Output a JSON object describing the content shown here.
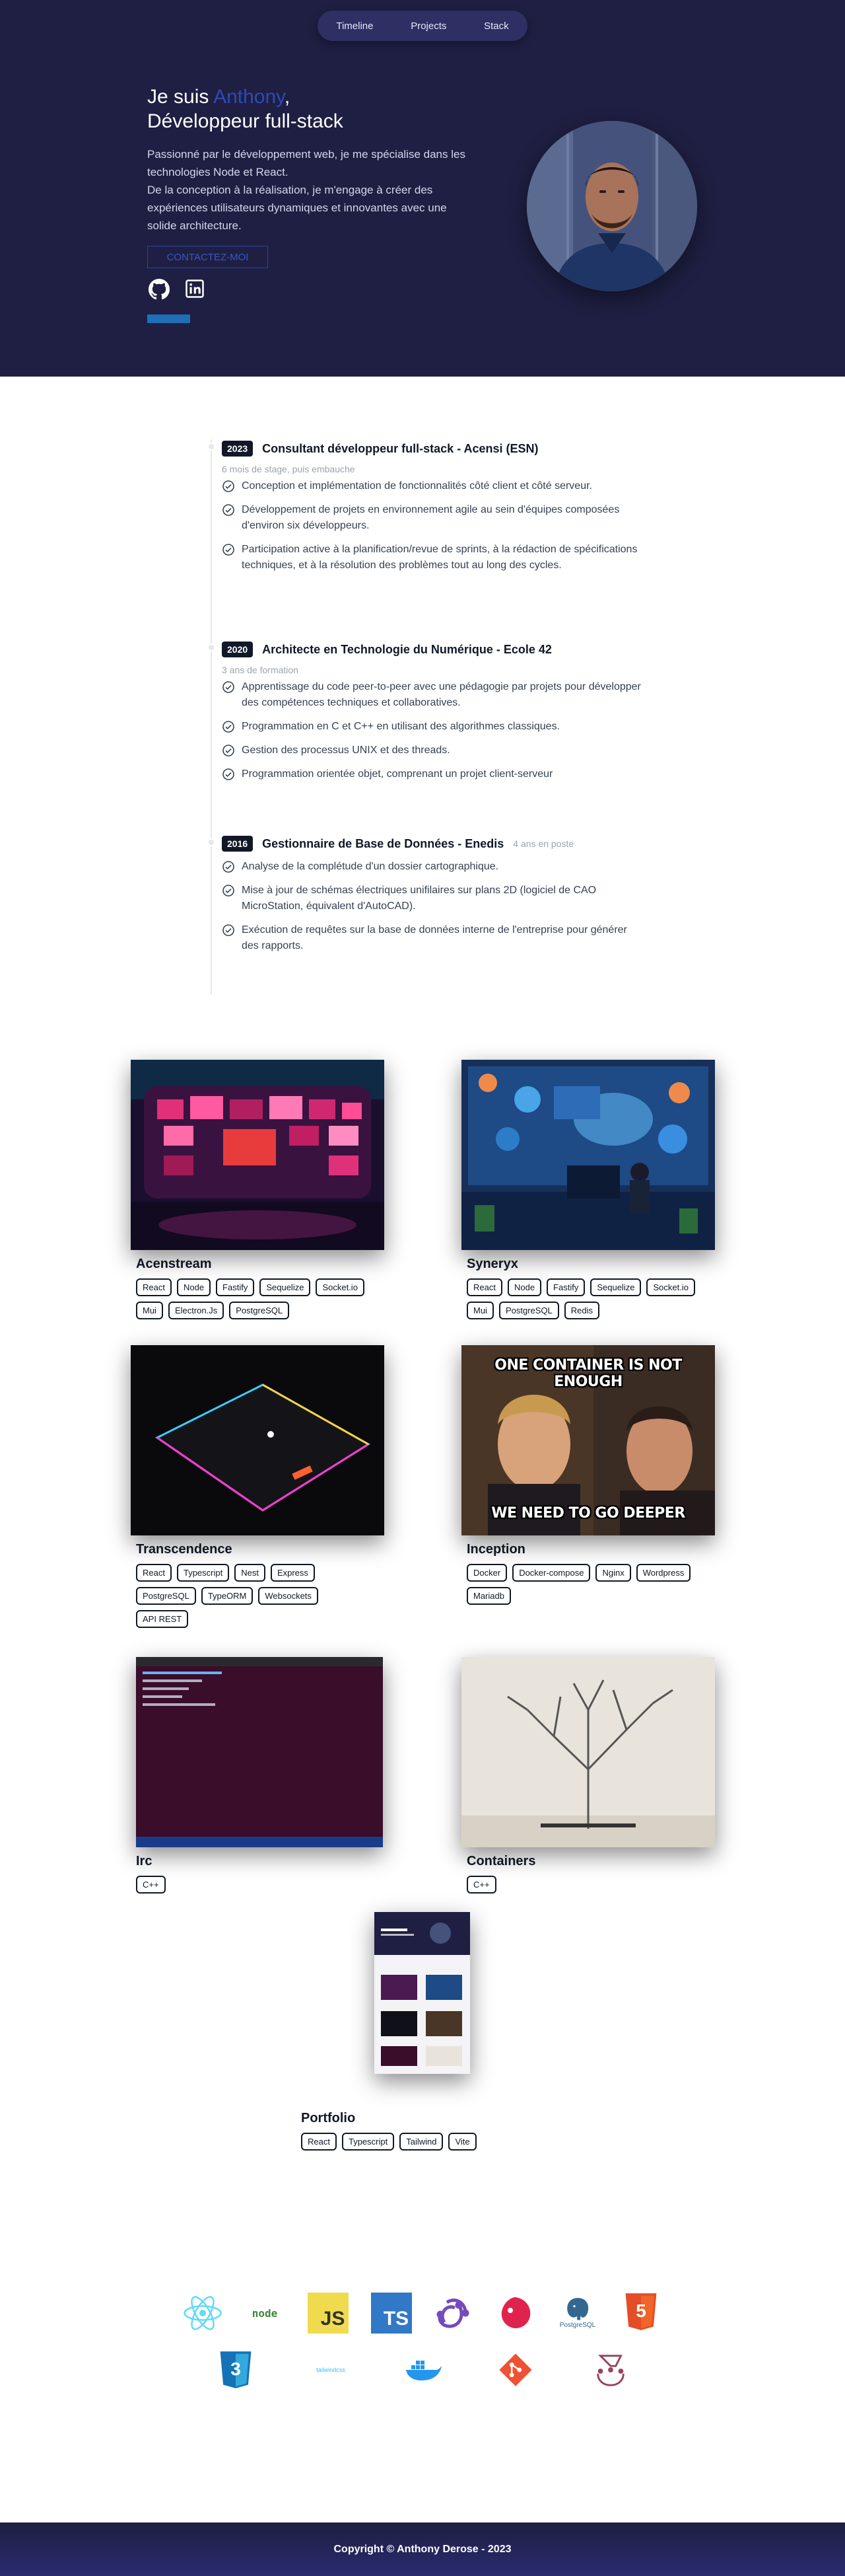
{
  "nav": {
    "items": [
      "Timeline",
      "Projects",
      "Stack"
    ]
  },
  "hero": {
    "greeting": "Je suis ",
    "name": "Anthony",
    "comma": ",",
    "role": "Développeur full-stack",
    "intro_1": "Passionné par le développement web, je me spécialise dans les technologies Node et React.",
    "intro_2": "De la conception à la réalisation, je m'engage à créer des expériences utilisateurs dynamiques et innovantes avec une solide architecture.",
    "contact_label": "CONTACTEZ-MOI",
    "social": [
      "github-icon",
      "linkedin-icon"
    ],
    "accent_color": "#2f4ab8",
    "background_color": "#1e1f42"
  },
  "timeline": [
    {
      "year": "2023",
      "title": "Consultant développeur full-stack - Acensi (ESN)",
      "subtitle": "6 mois de stage, puis embauche",
      "items": [
        "Conception et implémentation de fonctionnalités côté client et côté serveur.",
        "Développement de projets en environnement agile au sein d'équipes composées d'environ six développeurs.",
        "Participation active à la planification/revue de sprints, à la rédaction de spécifications techniques, et à la résolution des problèmes tout au long des cycles."
      ]
    },
    {
      "year": "2020",
      "title": "Architecte en Technologie du Numérique - Ecole 42",
      "subtitle": "3 ans de formation",
      "items": [
        "Apprentissage du code peer-to-peer avec une pédagogie par projets pour développer des compétences techniques et collaboratives.",
        "Programmation en C et C++ en utilisant des algorithmes classiques.",
        "Gestion des processus UNIX et des threads.",
        "Programmation orientée objet, comprenant un projet client-serveur"
      ]
    },
    {
      "year": "2016",
      "title": "Gestionnaire de Base de Données - Enedis",
      "note": "4 ans en poste",
      "items": [
        "Analyse de la complétude d'un dossier cartographique.",
        "Mise à jour de schémas électriques unifilaires sur plans 2D (logiciel de CAO MicroStation, équivalent d'AutoCAD).",
        "Exécution de requêtes sur la base de données interne de l'entreprise pour générer des rapports."
      ]
    }
  ],
  "projects": [
    {
      "name": "Acenstream",
      "tags": [
        "React",
        "Node",
        "Fastify",
        "Sequelize",
        "Socket.io",
        "Mui",
        "Electron.Js",
        "PostgreSQL"
      ]
    },
    {
      "name": "Syneryx",
      "tags": [
        "React",
        "Node",
        "Fastify",
        "Sequelize",
        "Socket.io",
        "Mui",
        "PostgreSQL",
        "Redis"
      ]
    },
    {
      "name": "Transcendence",
      "tags": [
        "React",
        "Typescript",
        "Nest",
        "Express",
        "PostgreSQL",
        "TypeORM",
        "Websockets",
        "API REST"
      ]
    },
    {
      "name": "Inception",
      "tags": [
        "Docker",
        "Docker-compose",
        "Nginx",
        "Wordpress",
        "Mariadb"
      ],
      "meme_top": "ONE CONTAINER IS NOT ENOUGH",
      "meme_bottom": "WE NEED TO GO DEEPER"
    },
    {
      "name": "Irc",
      "tags": [
        "C++"
      ]
    },
    {
      "name": "Containers",
      "tags": [
        "C++"
      ]
    },
    {
      "name": "Portfolio",
      "tags": [
        "React",
        "Typescript",
        "Tailwind",
        "Vite"
      ]
    }
  ],
  "skills": {
    "icons": [
      "react-icon",
      "nodejs-icon",
      "javascript-icon",
      "typescript-icon",
      "redux-icon",
      "nestjs-icon",
      "postgresql-icon",
      "html5-icon",
      "css3-icon",
      "tailwind-icon",
      "docker-icon",
      "git-icon",
      "jest-icon"
    ],
    "node_label": "node",
    "js_label": "JS",
    "ts_label": "TS",
    "pg_label": "PostgreSQL",
    "tw_label": "tailwindcss",
    "html_label": "5",
    "css_label": "3"
  },
  "footer": {
    "text": "Copyright © Anthony Derose - 2023"
  }
}
